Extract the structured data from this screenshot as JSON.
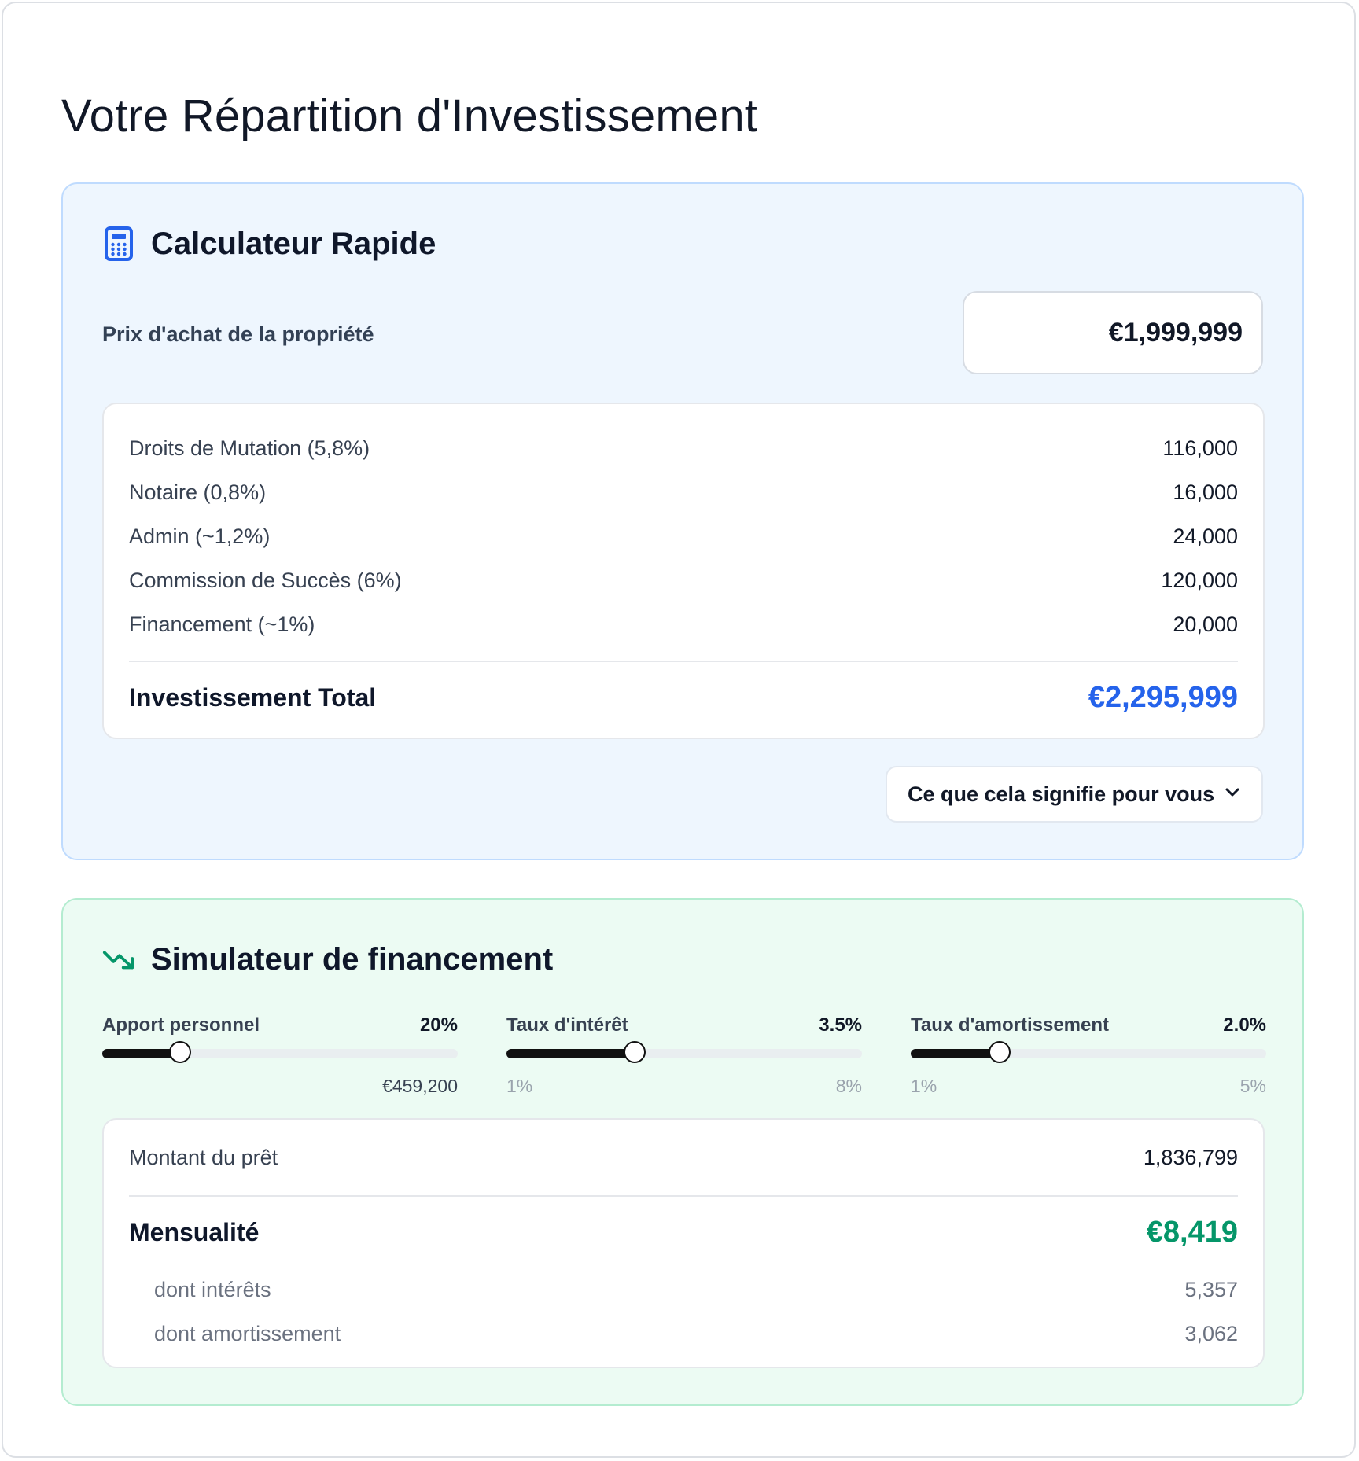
{
  "page": {
    "title": "Votre Répartition d'Investissement"
  },
  "calculator": {
    "title": "Calculateur Rapide",
    "icon": "calculator-icon",
    "price_label": "Prix d'achat de la propriété",
    "price_value": "€1,999,999",
    "fees": [
      {
        "label": "Droits de Mutation (5,8%)",
        "value": "116,000"
      },
      {
        "label": "Notaire (0,8%)",
        "value": "16,000"
      },
      {
        "label": "Admin (~1,2%)",
        "value": "24,000"
      },
      {
        "label": "Commission de Succès (6%)",
        "value": "120,000"
      },
      {
        "label": "Financement (~1%)",
        "value": "20,000"
      }
    ],
    "total_label": "Investissement Total",
    "total_value": "€2,295,999",
    "meaning_button": "Ce que cela signifie pour vous"
  },
  "financing": {
    "title": "Simulateur de financement",
    "icon": "trending-down-icon",
    "sliders": [
      {
        "label": "Apport personnel",
        "value_text": "20%",
        "fraction": 0.22,
        "foot_left": "",
        "foot_right": "€459,200"
      },
      {
        "label": "Taux d'intérêt",
        "value_text": "3.5%",
        "fraction": 0.36,
        "foot_left": "1%",
        "foot_right": "8%"
      },
      {
        "label": "Taux d'amortissement",
        "value_text": "2.0%",
        "fraction": 0.25,
        "foot_left": "1%",
        "foot_right": "5%"
      }
    ],
    "loan_label": "Montant du prêt",
    "loan_value": "1,836,799",
    "monthly_label": "Mensualité",
    "monthly_value": "€8,419",
    "interest_label": "dont intérêts",
    "interest_value": "5,357",
    "amortization_label": "dont amortissement",
    "amortization_value": "3,062"
  },
  "colors": {
    "accent_blue": "#2563eb",
    "accent_green": "#059669",
    "card_blue_bg": "#eef6fe",
    "card_green_bg": "#ecfbf3"
  }
}
